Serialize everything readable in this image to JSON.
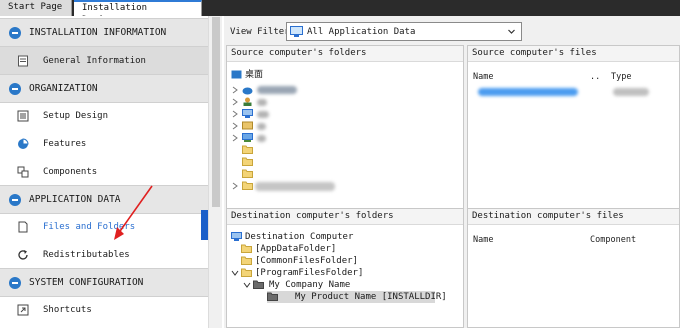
{
  "tabs": [
    {
      "label": "Start Page"
    },
    {
      "label": "Installation Designer"
    }
  ],
  "sidebar": {
    "sections": [
      {
        "label": "INSTALLATION INFORMATION",
        "items": [
          {
            "label": "General Information",
            "icon": "document-icon"
          }
        ]
      },
      {
        "label": "ORGANIZATION",
        "items": [
          {
            "label": "Setup Design",
            "icon": "list-icon"
          },
          {
            "label": "Features",
            "icon": "pie-icon"
          },
          {
            "label": "Components",
            "icon": "components-icon"
          }
        ]
      },
      {
        "label": "APPLICATION DATA",
        "items": [
          {
            "label": "Files and Folders",
            "icon": "file-icon"
          },
          {
            "label": "Redistributables",
            "icon": "refresh-icon"
          }
        ]
      },
      {
        "label": "SYSTEM CONFIGURATION",
        "items": [
          {
            "label": "Shortcuts",
            "icon": "shortcut-icon"
          }
        ]
      }
    ]
  },
  "view_filter": {
    "label": "View Filter",
    "value": "All Application Data"
  },
  "panes": {
    "source_folders": {
      "title": "Source computer's folders",
      "root": "桌面"
    },
    "source_files": {
      "title": "Source computer's files",
      "columns": [
        "Name",
        "..",
        "Type"
      ]
    },
    "dest_folders": {
      "title": "Destination computer's folders",
      "items": [
        "Destination Computer",
        "[AppDataFolder]",
        "[CommonFilesFolder]",
        "[ProgramFilesFolder]",
        "My Company Name",
        "My Product Name [INSTALLDIR]"
      ]
    },
    "dest_files": {
      "title": "Destination computer's files",
      "columns": [
        "Name",
        "Component"
      ]
    }
  },
  "colors": {
    "accent": "#2a78c8",
    "selection": "#1a5fc9",
    "link": "#2a6fd0"
  }
}
